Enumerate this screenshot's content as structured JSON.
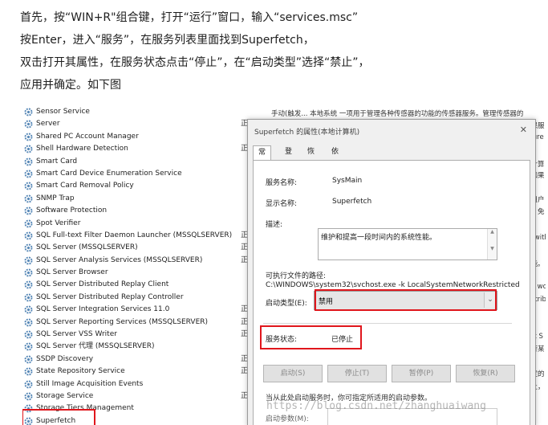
{
  "article": {
    "lines": [
      "首先，按“WIN+R\"组合键，打开“运行”窗口，输入“services.msc”",
      "按Enter，进入“服务”，在服务列表里面找到Superfetch，",
      "双击打开其属性，在服务状态点击“停止”，在“启动类型”选择“禁止”，",
      "应用并确定。如下图"
    ]
  },
  "services": [
    {
      "name": "Sensor Service",
      "status": ""
    },
    {
      "name": "Server",
      "status": "正"
    },
    {
      "name": "Shared PC Account Manager",
      "status": ""
    },
    {
      "name": "Shell Hardware Detection",
      "status": "正"
    },
    {
      "name": "Smart Card",
      "status": ""
    },
    {
      "name": "Smart Card Device Enumeration Service",
      "status": ""
    },
    {
      "name": "Smart Card Removal Policy",
      "status": ""
    },
    {
      "name": "SNMP Trap",
      "status": ""
    },
    {
      "name": "Software Protection",
      "status": ""
    },
    {
      "name": "Spot Verifier",
      "status": ""
    },
    {
      "name": "SQL Full-text Filter Daemon Launcher (MSSQLSERVER)",
      "status": "正"
    },
    {
      "name": "SQL Server (MSSQLSERVER)",
      "status": "正"
    },
    {
      "name": "SQL Server Analysis Services (MSSQLSERVER)",
      "status": "正"
    },
    {
      "name": "SQL Server Browser",
      "status": ""
    },
    {
      "name": "SQL Server Distributed Replay Client",
      "status": ""
    },
    {
      "name": "SQL Server Distributed Replay Controller",
      "status": ""
    },
    {
      "name": "SQL Server Integration Services 11.0",
      "status": "正"
    },
    {
      "name": "SQL Server Reporting Services (MSSQLSERVER)",
      "status": "正"
    },
    {
      "name": "SQL Server VSS Writer",
      "status": "正"
    },
    {
      "name": "SQL Server 代理 (MSSQLSERVER)",
      "status": ""
    },
    {
      "name": "SSDP Discovery",
      "status": "正"
    },
    {
      "name": "State Repository Service",
      "status": "正"
    },
    {
      "name": "Still Image Acquisition Events",
      "status": ""
    },
    {
      "name": "Storage Service",
      "status": "正"
    },
    {
      "name": "Storage Tiers Management",
      "status": ""
    },
    {
      "name": "Superfetch",
      "status": ""
    }
  ],
  "list_description_top": "手动(触发...   本地系统   一项用于管理各种传感器的功能的传感器服务。管理传感器的",
  "edge_texts": [
    "如果服",
    "figure",
    "此计算",
    "。如果",
    "的用户",
    "载，免",
    "ch with",
    "功能。",
    "hat wo",
    "Distrib",
    "soft S",
    "执行某",
    "指定的",
    "停止，"
  ],
  "dialog": {
    "title": "Superfetch 的属性(本地计算机)",
    "close": "✕",
    "tabs": [
      "常规",
      "登录",
      "恢复",
      "依存关系"
    ],
    "service_name_label": "服务名称:",
    "service_name": "SysMain",
    "display_name_label": "显示名称:",
    "display_name": "Superfetch",
    "desc_label": "描述:",
    "desc": "维护和提高一段时间内的系统性能。",
    "exe_label": "可执行文件的路径:",
    "exe_path": "C:\\WINDOWS\\system32\\svchost.exe -k LocalSystemNetworkRestricted",
    "startup_label": "启动类型(E):",
    "startup_value": "禁用",
    "status_label": "服务状态:",
    "status_value": "已停止",
    "buttons": [
      "启动(S)",
      "停止(T)",
      "暂停(P)",
      "恢复(R)"
    ],
    "hint": "当从此处启动服务时，你可指定所适用的启动参数。",
    "param_label": "启动参数(M):"
  },
  "watermark": "https://blog.csdn.net/zhanghuaiwang",
  "colors": {
    "highlight": "#e0161c",
    "icon": "#5a8ab8"
  }
}
